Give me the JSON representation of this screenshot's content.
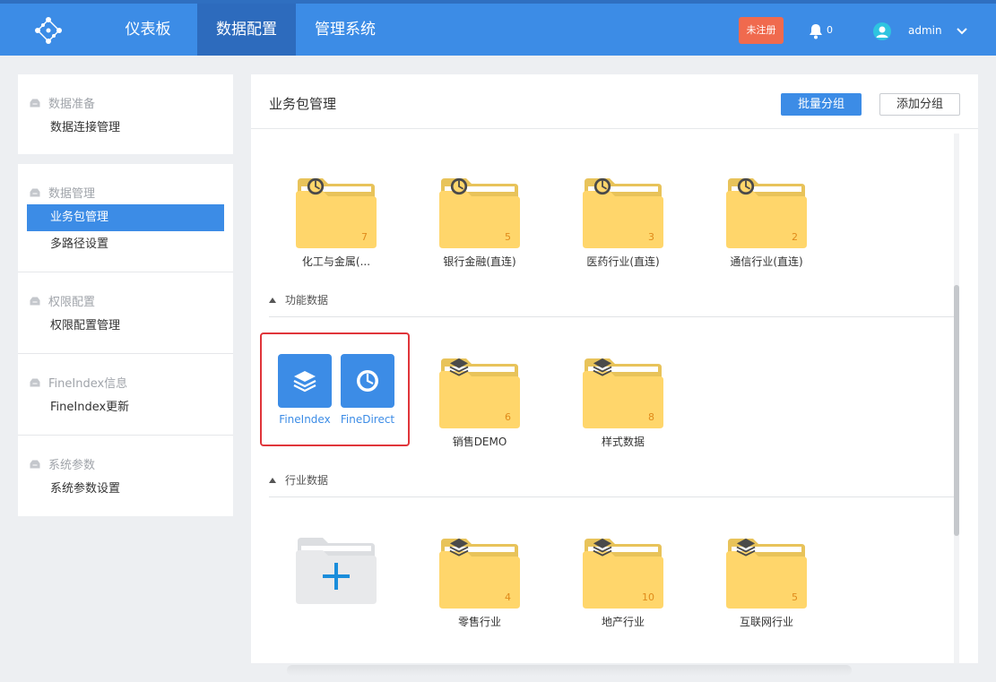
{
  "topnav": {
    "items": [
      {
        "label": "仪表板"
      },
      {
        "label": "数据配置"
      },
      {
        "label": "管理系统"
      }
    ],
    "unregistered_label": "未注册",
    "notification_count": "0",
    "username": "admin"
  },
  "sidebar": {
    "groups": [
      {
        "title": "数据准备",
        "items": [
          "数据连接管理"
        ]
      },
      {
        "title": "数据管理",
        "items": [
          "业务包管理",
          "多路径设置"
        ]
      },
      {
        "title": "权限配置",
        "items": [
          "权限配置管理"
        ]
      },
      {
        "title": "FineIndex信息",
        "items": [
          "FineIndex更新"
        ]
      },
      {
        "title": "系统参数",
        "items": [
          "系统参数设置"
        ]
      }
    ],
    "active_item": "业务包管理"
  },
  "main": {
    "title": "业务包管理",
    "batch_group_label": "批量分组",
    "add_group_label": "添加分组",
    "top_folders": [
      {
        "name": "化工与金属(...",
        "count": "7",
        "icon": "clock-icon"
      },
      {
        "name": "银行金融(直连)",
        "count": "5",
        "icon": "clock-icon"
      },
      {
        "name": "医药行业(直连)",
        "count": "3",
        "icon": "clock-icon"
      },
      {
        "name": "通信行业(直连)",
        "count": "2",
        "icon": "clock-icon"
      }
    ],
    "sections": [
      {
        "title": "功能数据",
        "tiles": [
          {
            "name": "FineIndex",
            "icon": "layers-icon"
          },
          {
            "name": "FineDirect",
            "icon": "clock-icon"
          }
        ],
        "folders": [
          {
            "name": "销售DEMO",
            "count": "6",
            "icon": "layers-icon"
          },
          {
            "name": "样式数据",
            "count": "8",
            "icon": "layers-icon"
          }
        ]
      },
      {
        "title": "行业数据",
        "folders": [
          {
            "name": "零售行业",
            "count": "4",
            "icon": "layers-icon"
          },
          {
            "name": "地产行业",
            "count": "10",
            "icon": "layers-icon"
          },
          {
            "name": "互联网行业",
            "count": "5",
            "icon": "layers-icon"
          }
        ]
      }
    ]
  },
  "colors": {
    "topbar": "#3c8ce6",
    "nav_active": "#2d6bbd",
    "folder": "#ffd66b",
    "folder_back": "#e8c35a",
    "highlight_border": "#e0353a",
    "unregistered_badge": "#f06a4e"
  }
}
